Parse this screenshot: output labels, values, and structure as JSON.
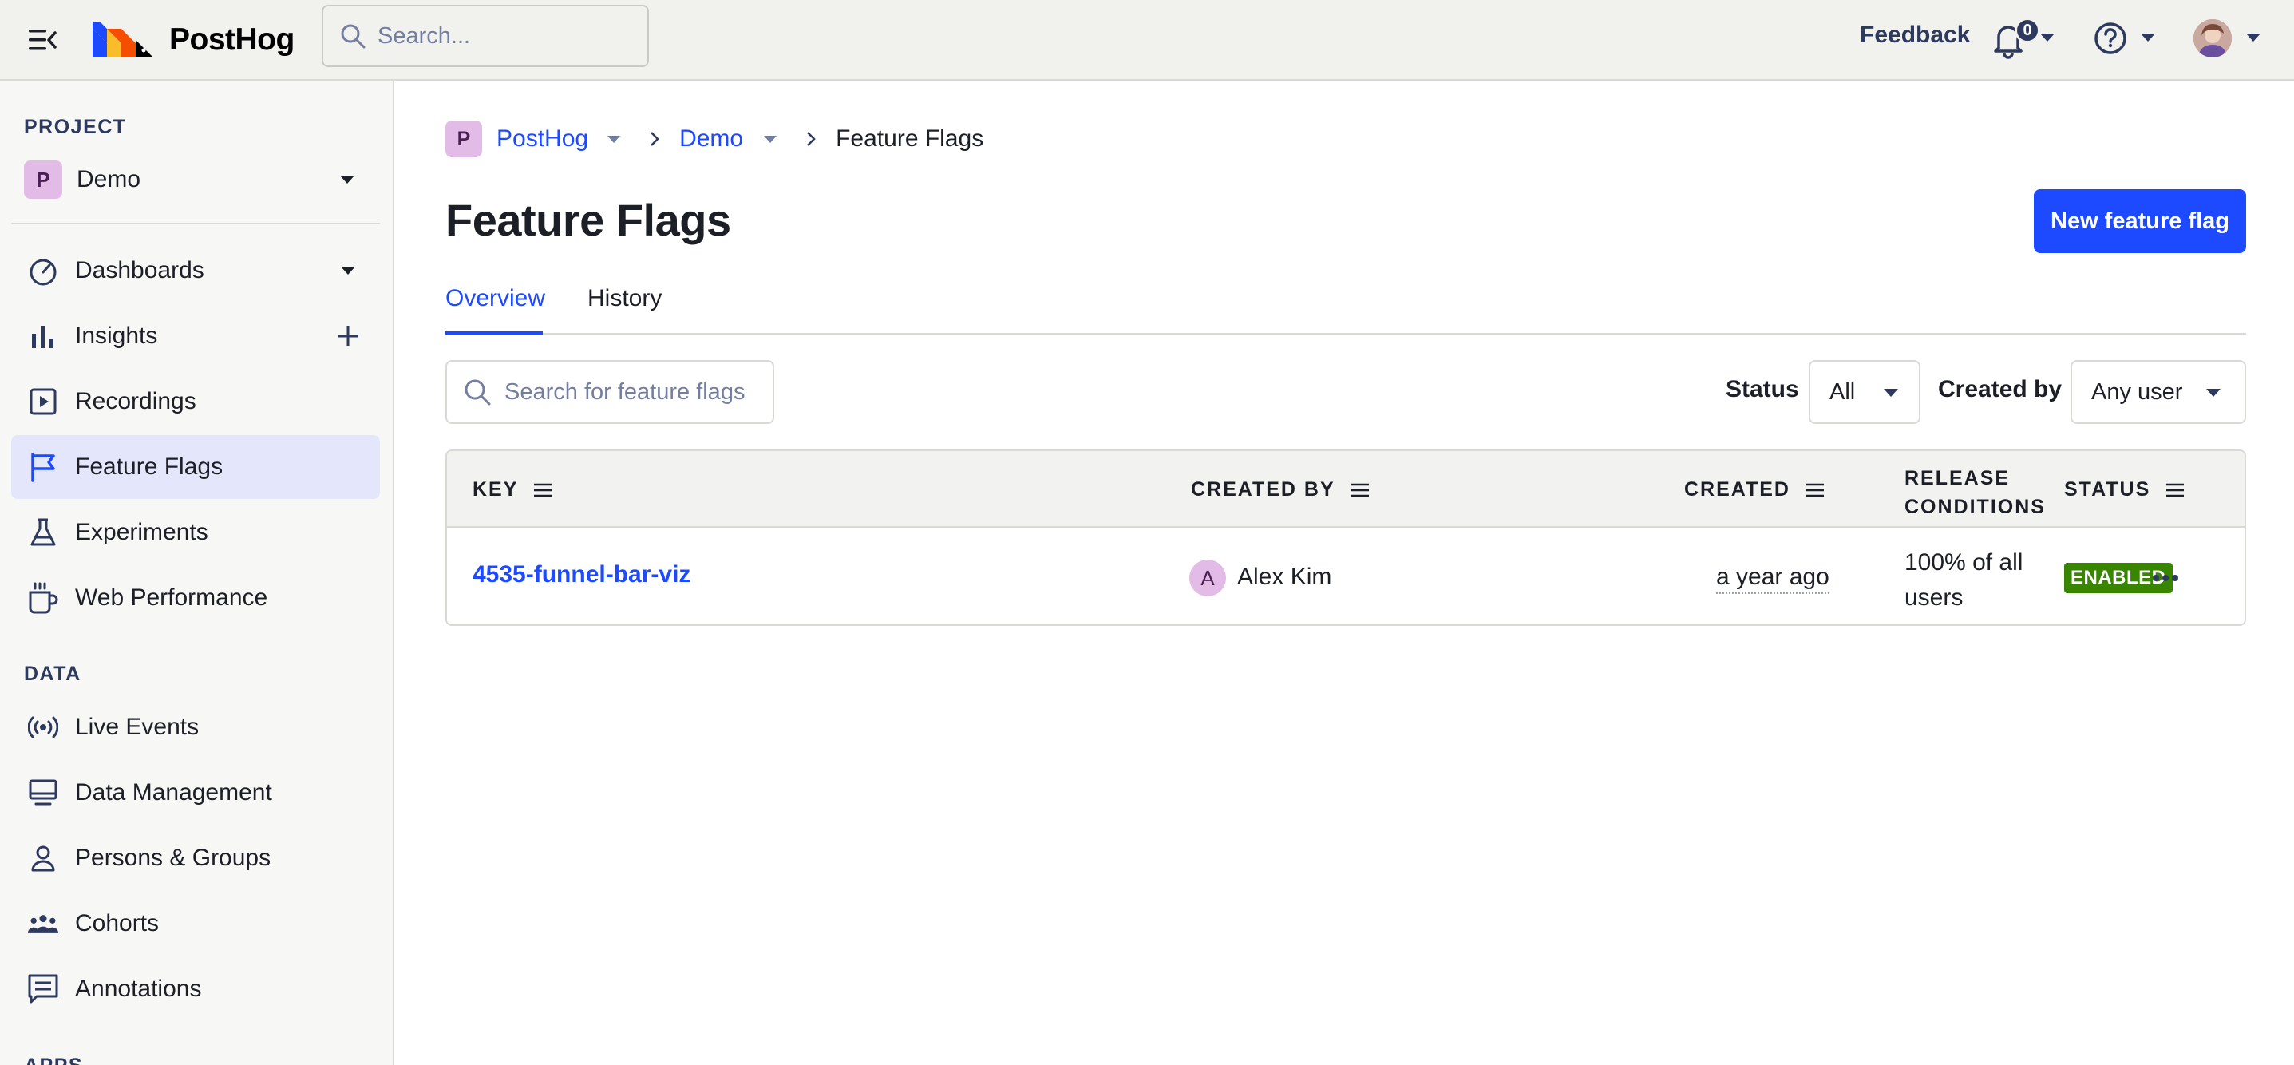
{
  "topbar": {
    "logo_text": "PostHog",
    "search_placeholder": "Search...",
    "feedback_label": "Feedback",
    "notification_count": "0"
  },
  "sidebar": {
    "project_section_label": "PROJECT",
    "project_badge": "P",
    "project_name": "Demo",
    "items": [
      {
        "label": "Dashboards",
        "icon": "dashboard-gauge-icon"
      },
      {
        "label": "Insights",
        "icon": "bar-chart-icon"
      },
      {
        "label": "Recordings",
        "icon": "play-square-icon"
      },
      {
        "label": "Feature Flags",
        "icon": "flag-icon",
        "active": true
      },
      {
        "label": "Experiments",
        "icon": "flask-icon"
      },
      {
        "label": "Web Performance",
        "icon": "coffee-cup-icon"
      }
    ],
    "data_section_label": "DATA",
    "data_items": [
      {
        "label": "Live Events",
        "icon": "broadcast-icon"
      },
      {
        "label": "Data Management",
        "icon": "monitor-icon"
      },
      {
        "label": "Persons & Groups",
        "icon": "person-icon"
      },
      {
        "label": "Cohorts",
        "icon": "people-group-icon"
      },
      {
        "label": "Annotations",
        "icon": "comment-icon"
      }
    ],
    "apps_section_label": "APPS"
  },
  "main": {
    "breadcrumb": {
      "org_badge": "P",
      "org": "PostHog",
      "project": "Demo",
      "current": "Feature Flags"
    },
    "title": "Feature Flags",
    "new_button_label": "New feature flag",
    "tabs": [
      {
        "label": "Overview",
        "active": true
      },
      {
        "label": "History",
        "active": false
      }
    ],
    "search_placeholder": "Search for feature flags",
    "filters": {
      "status_label": "Status",
      "status_value": "All",
      "created_by_label": "Created by",
      "created_by_value": "Any user"
    },
    "table": {
      "columns": {
        "key": "KEY",
        "created_by": "CREATED BY",
        "created": "CREATED",
        "release_line1": "RELEASE",
        "release_line2": "CONDITIONS",
        "status": "STATUS"
      },
      "rows": [
        {
          "key": "4535-funnel-bar-viz",
          "user_initial": "A",
          "user_name": "Alex Kim",
          "created": "a year ago",
          "release_conditions": "100% of all users",
          "status": "ENABLED"
        }
      ]
    }
  },
  "colors": {
    "accent": "#1d4aff",
    "active_nav_bg": "#e4e7fb",
    "badge_bg": "#e2bce6",
    "status_enabled": "#388600"
  }
}
